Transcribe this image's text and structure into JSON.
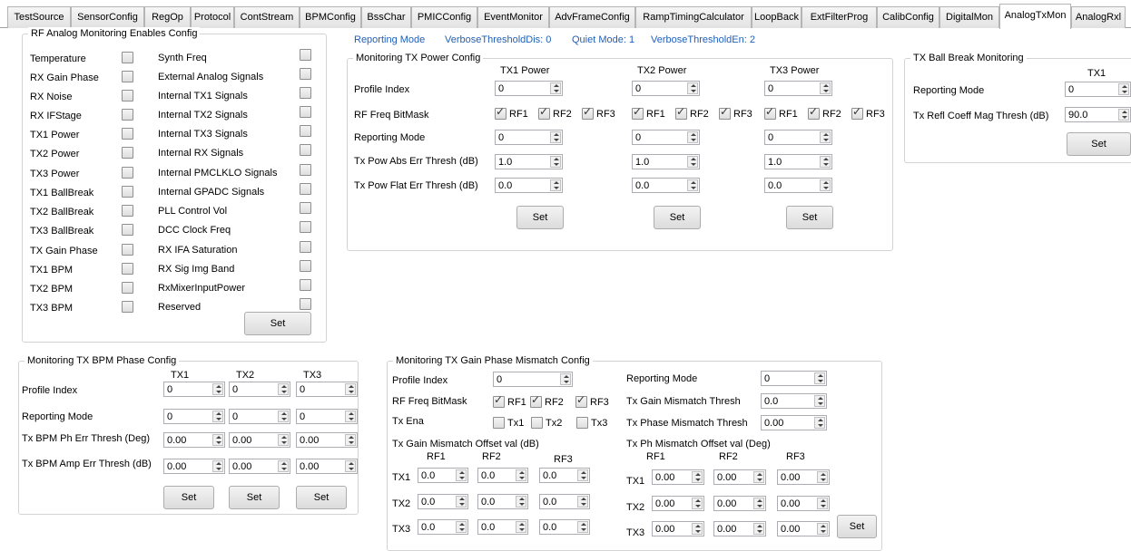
{
  "tabs": [
    "TestSource",
    "SensorConfig",
    "RegOp",
    "Protocol",
    "ContStream",
    "BPMConfig",
    "BssChar",
    "PMICConfig",
    "EventMonitor",
    "AdvFrameConfig",
    "RampTimingCalculator",
    "LoopBack",
    "ExtFilterProg",
    "CalibConfig",
    "DigitalMon",
    "AnalogTxMon",
    "AnalogRxl"
  ],
  "status": {
    "reporting_mode": "Reporting Mode",
    "verbose_dis": "VerboseThresholdDis: 0",
    "quiet": "Quiet Mode: 1",
    "verbose_en": "VerboseThresholdEn: 2"
  },
  "rf_enables": {
    "title": "RF Analog Monitoring Enables Config",
    "left": [
      "Temperature",
      "RX Gain Phase",
      "RX Noise",
      "RX IFStage",
      "TX1 Power",
      "TX2 Power",
      "TX3 Power",
      "TX1 BallBreak",
      "TX2 BallBreak",
      "TX3 BallBreak",
      "TX Gain Phase",
      "TX1 BPM",
      "TX2 BPM",
      "TX3 BPM"
    ],
    "right": [
      "Synth Freq",
      "External Analog Signals",
      "Internal TX1 Signals",
      "Internal TX2 Signals",
      "Internal TX3 Signals",
      "Internal RX Signals",
      "Internal PMCLKLO Signals",
      "Internal GPADC Signals",
      "PLL Control Vol",
      "DCC Clock Freq",
      "RX IFA Saturation",
      "RX Sig Img Band",
      "RxMixerInputPower",
      "Reserved"
    ],
    "set": "Set"
  },
  "tx_power": {
    "title": "Monitoring TX Power Config",
    "cols": [
      "TX1 Power",
      "TX2 Power",
      "TX3 Power"
    ],
    "rows": [
      "Profile Index",
      "RF Freq BitMask",
      "Reporting Mode",
      "Tx Pow Abs Err Thresh (dB)",
      "Tx Pow Flat Err Thresh (dB)"
    ],
    "profile": [
      "0",
      "0",
      "0"
    ],
    "rf_labels": [
      "RF1",
      "RF2",
      "RF3"
    ],
    "reporting": [
      "0",
      "0",
      "0"
    ],
    "abs": [
      "1.0",
      "1.0",
      "1.0"
    ],
    "flat": [
      "0.0",
      "0.0",
      "0.0"
    ],
    "set": "Set"
  },
  "ball_break": {
    "title": "TX Ball Break Monitoring",
    "col": "TX1",
    "rows": [
      "Reporting Mode",
      "Tx Refl Coeff Mag Thresh (dB)"
    ],
    "reporting": "0",
    "thresh": "90.0",
    "set": "Set"
  },
  "bpm": {
    "title": "Monitoring TX BPM Phase Config",
    "cols": [
      "TX1",
      "TX2",
      "TX3"
    ],
    "rows": [
      "Profile Index",
      "Reporting Mode",
      "Tx BPM Ph Err Thresh (Deg)",
      "Tx BPM Amp Err Thresh (dB)"
    ],
    "profile": [
      "0",
      "0",
      "0"
    ],
    "reporting": [
      "0",
      "0",
      "0"
    ],
    "ph": [
      "0.00",
      "0.00",
      "0.00"
    ],
    "amp": [
      "0.00",
      "0.00",
      "0.00"
    ],
    "set": "Set"
  },
  "gain_phase": {
    "title": "Monitoring TX Gain Phase Mismatch Config",
    "profile_label": "Profile Index",
    "profile": "0",
    "rf_label": "RF Freq BitMask",
    "rf": [
      "RF1",
      "RF2",
      "RF3"
    ],
    "txena_label": "Tx Ena",
    "txena": [
      "Tx1",
      "Tx2",
      "Tx3"
    ],
    "reporting_label": "Reporting Mode",
    "reporting": "0",
    "gain_thresh_label": "Tx Gain Mismatch Thresh",
    "gain_thresh": "0.0",
    "phase_thresh_label": "Tx Phase Mismatch Thresh",
    "phase_thresh": "0.00",
    "gain_off_label": "Tx Gain Mismatch Offset val (dB)",
    "ph_off_label": "Tx Ph Mismatch Offset val (Deg)",
    "rf_cols": [
      "RF1",
      "RF2",
      "RF3"
    ],
    "tx_rows": [
      "TX1",
      "TX2",
      "TX3"
    ],
    "gain_vals": [
      "0.0",
      "0.0",
      "0.0"
    ],
    "ph_vals": [
      "0.00",
      "0.00",
      "0.00"
    ],
    "set": "Set"
  }
}
